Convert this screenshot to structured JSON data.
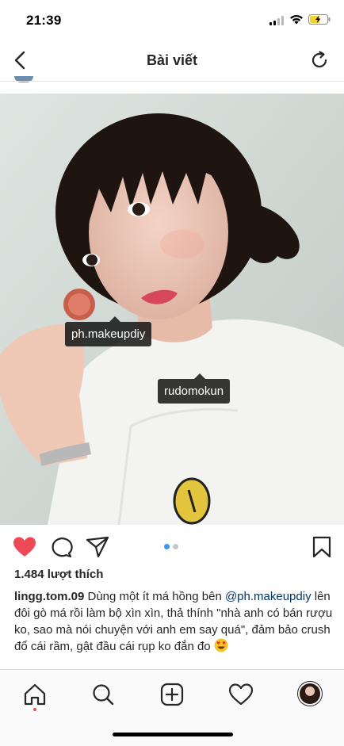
{
  "status_bar": {
    "time": "21:39",
    "icons": [
      "signal-icon",
      "wifi-icon",
      "battery-charging-icon"
    ]
  },
  "nav": {
    "title": "Bài viết",
    "back_icon": "chevron-left-icon",
    "refresh_icon": "refresh-icon"
  },
  "post": {
    "photo_tags": [
      "ph.makeupdiy",
      "rudomokun"
    ],
    "carousel": {
      "current": 1,
      "total": 2
    },
    "likes_text": "1.484 lượt thích",
    "caption": {
      "username": "lingg.tom.09",
      "text_1": " Dùng một ít má hồng bên ",
      "mention": "@ph.makeupdiy",
      "text_2": " lên đôi gò má rồi làm bộ xìn xìn, thả thính \"nhà anh có bán rượu ko, sao mà nói chuyện với anh em say quá\", đảm bảo crush đổ cái rầm, gật đầu cái rụp ko đắn đo ",
      "emoji": "heart-eyes-emoji"
    },
    "actions": [
      "heart-filled-icon",
      "comment-icon",
      "share-icon",
      "bookmark-icon"
    ]
  },
  "tab_bar": {
    "items": [
      "home-icon",
      "search-icon",
      "add-post-icon",
      "activity-heart-icon",
      "profile-avatar"
    ]
  },
  "colors": {
    "like_red": "#ed4956",
    "carousel_active": "#3897f0",
    "carousel_inactive": "#c7c7c7",
    "mention_blue": "#003569",
    "text": "#262626",
    "notification_dot": "#ed4956",
    "battery_yellow": "#f5d328"
  }
}
